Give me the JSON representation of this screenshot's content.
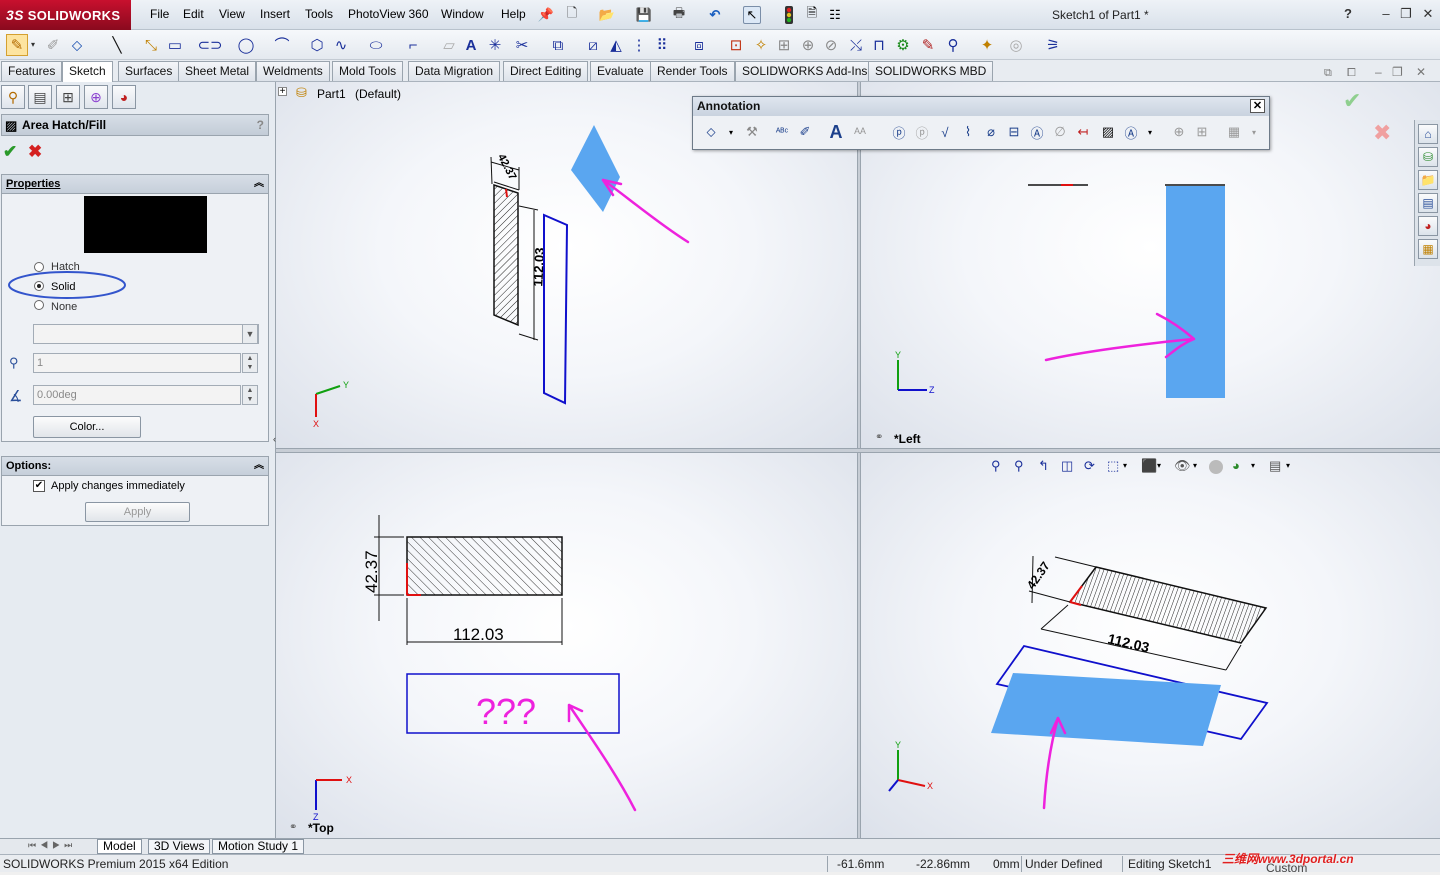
{
  "app": {
    "brand": "SOLIDWORKS",
    "brand_prefix": "3S",
    "doc_title": "Sketch1 of Part1 *"
  },
  "menu": [
    "File",
    "Edit",
    "View",
    "Insert",
    "Tools",
    "PhotoView 360",
    "Window",
    "Help"
  ],
  "tabs": [
    "Features",
    "Sketch",
    "Surfaces",
    "Sheet Metal",
    "Weldments",
    "Mold Tools",
    "Data Migration",
    "Direct Editing",
    "Evaluate",
    "Render Tools",
    "SOLIDWORKS Add-Ins",
    "SOLIDWORKS MBD"
  ],
  "active_tab": "Sketch",
  "property_manager": {
    "title": "Area Hatch/Fill",
    "help": "?",
    "properties_label": "Properties",
    "fill_color": "#000000",
    "options": {
      "hatch": "Hatch",
      "solid": "Solid",
      "none": "None"
    },
    "selected": "Solid",
    "pattern_value": "",
    "scale_value": "1",
    "angle_value": "0.00deg",
    "color_button": "Color...",
    "options_label": "Options:",
    "apply_immediately_label": "Apply changes immediately",
    "apply_immediately": true,
    "apply_button": "Apply"
  },
  "tree": {
    "root": "Part1",
    "config": "(Default)"
  },
  "annotation_toolbar": {
    "title": "Annotation",
    "close": "✕"
  },
  "viewports": {
    "top_left": {
      "dim_width": "42.37",
      "dim_length": "112.03",
      "triad": {
        "y": "Y",
        "x": "X"
      }
    },
    "top_right": {
      "label": "*Left",
      "triad": {
        "y": "Y",
        "z": "Z"
      }
    },
    "bottom_left": {
      "label": "*Top",
      "dim_height": "42.37",
      "dim_length": "112.03",
      "note": "???",
      "triad": {
        "x": "X",
        "z": "Z"
      }
    },
    "bottom_right": {
      "dim_width": "42.37",
      "dim_length": "112.03",
      "triad": {
        "y": "Y",
        "x": "X"
      }
    }
  },
  "colors": {
    "fill_blue": "#5aa6f0",
    "sketch_blue": "#1010cc",
    "annotation_magenta": "#ee22dd",
    "ok_green": "#2a9a2a",
    "cancel_red": "#d42020",
    "ellipse": "#3355cc"
  },
  "bottom_tabs": [
    "Model",
    "3D Views",
    "Motion Study 1"
  ],
  "status": {
    "edition": "SOLIDWORKS Premium 2015 x64 Edition",
    "x": "-61.6mm",
    "y": "-22.86mm",
    "z": "0mm",
    "state": "Under Defined",
    "editing": "Editing Sketch1",
    "units": "Custom",
    "watermark": "三维网www.3dportal.cn"
  }
}
